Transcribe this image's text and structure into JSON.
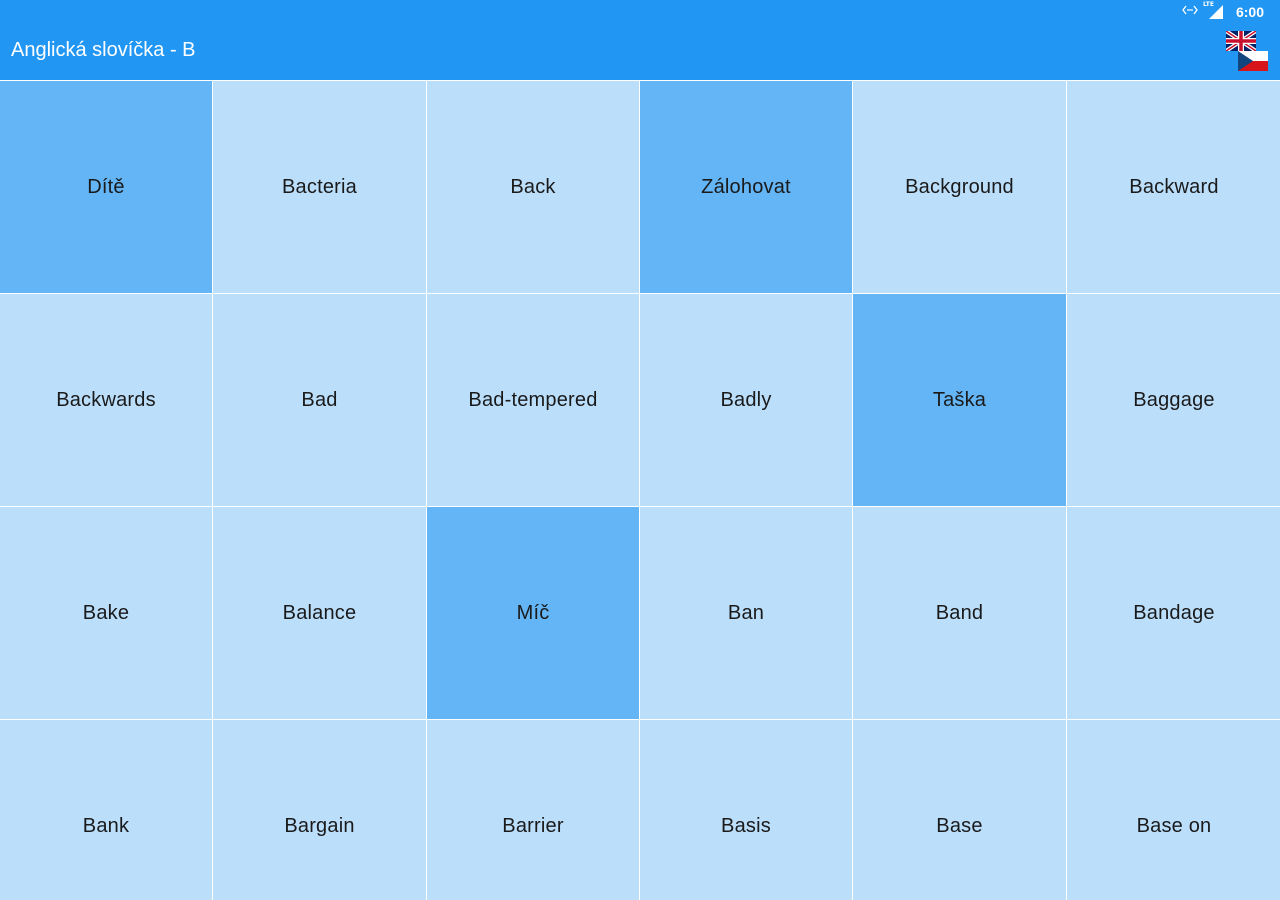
{
  "status_bar": {
    "time": "6:00",
    "network_label": "LTE",
    "icons": [
      "data-transfer-icon",
      "signal-icon"
    ]
  },
  "app_bar": {
    "title": "Anglická slovíčka - B",
    "language_toggle": {
      "primary": "uk-flag-icon",
      "secondary": "cz-flag-icon"
    }
  },
  "colors": {
    "primary": "#2196f3",
    "tile": "#bbdefb",
    "tile_flipped": "#64b5f6",
    "text": "#1a1a1a"
  },
  "tiles": [
    {
      "label": "Dítě",
      "flipped": true
    },
    {
      "label": "Bacteria",
      "flipped": false
    },
    {
      "label": "Back",
      "flipped": false
    },
    {
      "label": "Zálohovat",
      "flipped": true
    },
    {
      "label": "Background",
      "flipped": false
    },
    {
      "label": "Backward",
      "flipped": false
    },
    {
      "label": "Backwards",
      "flipped": false
    },
    {
      "label": "Bad",
      "flipped": false
    },
    {
      "label": "Bad-tempered",
      "flipped": false
    },
    {
      "label": "Badly",
      "flipped": false
    },
    {
      "label": "Taška",
      "flipped": true
    },
    {
      "label": "Baggage",
      "flipped": false
    },
    {
      "label": "Bake",
      "flipped": false
    },
    {
      "label": "Balance",
      "flipped": false
    },
    {
      "label": "Míč",
      "flipped": true
    },
    {
      "label": "Ban",
      "flipped": false
    },
    {
      "label": "Band",
      "flipped": false
    },
    {
      "label": "Bandage",
      "flipped": false
    },
    {
      "label": "Bank",
      "flipped": false
    },
    {
      "label": "Bargain",
      "flipped": false
    },
    {
      "label": "Barrier",
      "flipped": false
    },
    {
      "label": "Basis",
      "flipped": false
    },
    {
      "label": "Base",
      "flipped": false
    },
    {
      "label": "Base on",
      "flipped": false
    }
  ]
}
